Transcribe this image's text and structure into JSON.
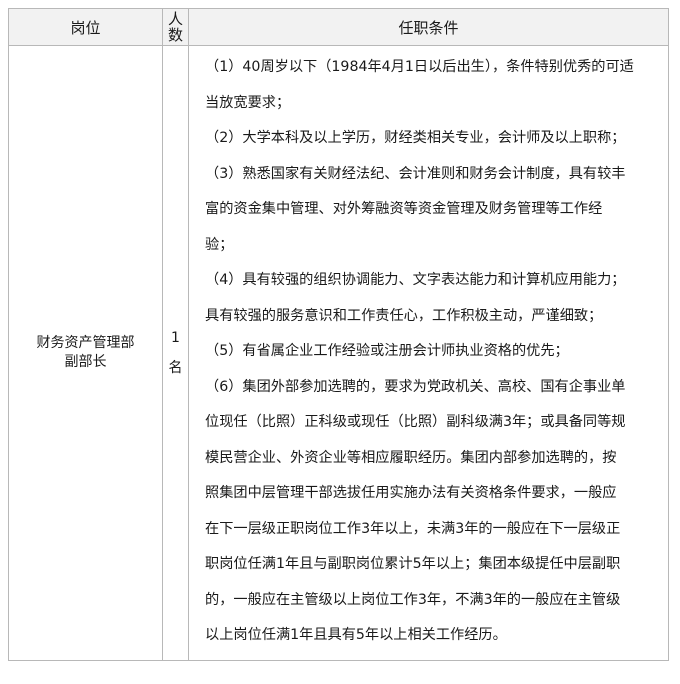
{
  "table": {
    "headers": {
      "position": "岗位",
      "count_chars": [
        "人",
        "数"
      ],
      "conditions": "任职条件"
    },
    "row": {
      "position_lines": [
        "财务资产管理部",
        "副部长"
      ],
      "count_chars": [
        "1",
        "名"
      ],
      "condition_lines": [
        "（1）40周岁以下（1984年4月1日以后出生），条件特别优秀的可适",
        "当放宽要求；",
        "（2）大学本科及以上学历，财经类相关专业，会计师及以上职称；",
        "（3）熟悉国家有关财经法纪、会计准则和财务会计制度，具有较丰",
        "富的资金集中管理、对外筹融资等资金管理及财务管理等工作经",
        "验；",
        "（4）具有较强的组织协调能力、文字表达能力和计算机应用能力；",
        "具有较强的服务意识和工作责任心，工作积极主动，严谨细致；",
        "（5）有省属企业工作经验或注册会计师执业资格的优先；",
        "（6）集团外部参加选聘的，要求为党政机关、高校、国有企事业单",
        "位现任（比照）正科级或现任（比照）副科级满3年；或具备同等规",
        "模民营企业、外资企业等相应履职经历。集团内部参加选聘的，按",
        "照集团中层管理干部选拔任用实施办法有关资格条件要求，一般应",
        "在下一层级正职岗位工作3年以上，未满3年的一般应在下一层级正",
        "职岗位任满1年且与副职岗位累计5年以上；集团本级提任中层副职",
        "的，一般应在主管级以上岗位工作3年，不满3年的一般应在主管级",
        "以上岗位任满1年且具有5年以上相关工作经历。"
      ]
    }
  }
}
